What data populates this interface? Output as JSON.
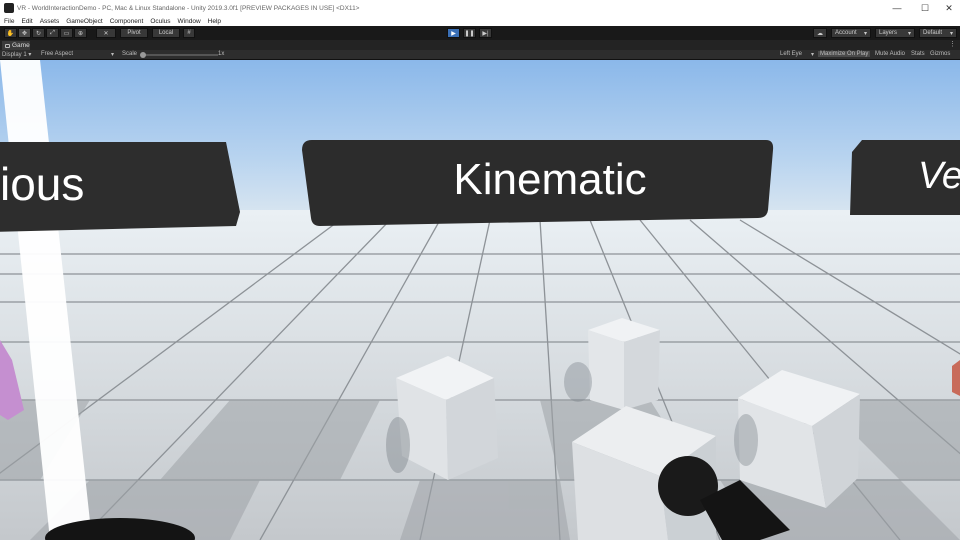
{
  "window": {
    "title": "VR - WorldInteractionDemo - PC, Mac & Linux Standalone - Unity 2019.3.0f1 [PREVIEW PACKAGES IN USE] <DX11>",
    "minimize": "—",
    "maximize": "☐",
    "close": "✕"
  },
  "menu": [
    "File",
    "Edit",
    "Assets",
    "GameObject",
    "Component",
    "Oculus",
    "Window",
    "Help"
  ],
  "toolbar": {
    "pivot": "Pivot",
    "local": "Local",
    "account": "Account",
    "layers": "Layers",
    "layout": "Default"
  },
  "game_tab": {
    "label": "Game"
  },
  "game_toolbar": {
    "display": "Display 1",
    "aspect": "Free Aspect",
    "scale_label": "Scale",
    "scale_value": "1x",
    "eye": "Left Eye",
    "maximize_on_play": "Maximize On Play",
    "mute_audio": "Mute Audio",
    "stats": "Stats",
    "gizmos": "Gizmos"
  },
  "scene": {
    "sign_left": "ious",
    "sign_center": "Kinematic",
    "sign_right": "Ve"
  }
}
